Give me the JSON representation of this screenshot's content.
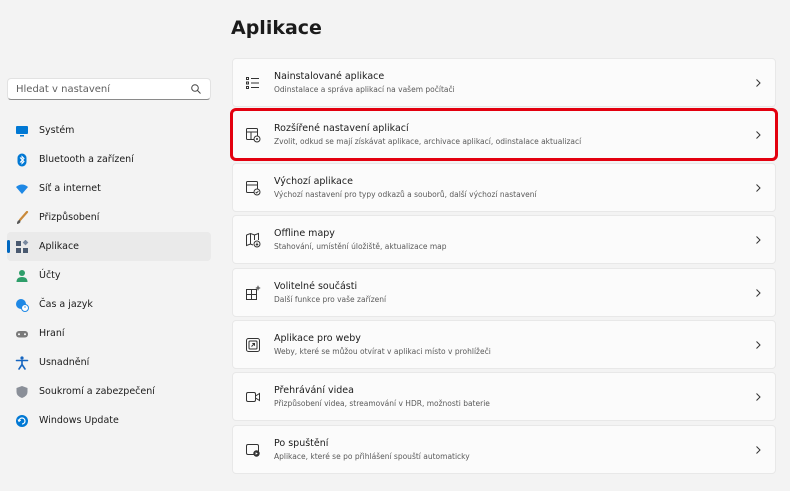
{
  "page": {
    "title": "Aplikace"
  },
  "search": {
    "placeholder": "Hledat v nastavení"
  },
  "sidebar": {
    "items": [
      {
        "label": "Systém",
        "icon": "monitor-icon",
        "color": "#0078d4"
      },
      {
        "label": "Bluetooth a zařízení",
        "icon": "bluetooth-icon",
        "color": "#0078d4"
      },
      {
        "label": "Síť a internet",
        "icon": "wifi-icon",
        "color": "#1e88e5"
      },
      {
        "label": "Přizpůsobení",
        "icon": "brush-icon",
        "color": "#c98a3a"
      },
      {
        "label": "Aplikace",
        "icon": "apps-icon",
        "color": "#4a5a70",
        "active": true
      },
      {
        "label": "Účty",
        "icon": "person-icon",
        "color": "#2e9e6a"
      },
      {
        "label": "Čas a jazyk",
        "icon": "globe-clock-icon",
        "color": "#1e88e5"
      },
      {
        "label": "Hraní",
        "icon": "gamepad-icon",
        "color": "#7a7a7a"
      },
      {
        "label": "Usnadnění",
        "icon": "accessibility-icon",
        "color": "#1565c0"
      },
      {
        "label": "Soukromí a zabezpečení",
        "icon": "shield-icon",
        "color": "#8a8f98"
      },
      {
        "label": "Windows Update",
        "icon": "update-icon",
        "color": "#0078d4"
      }
    ]
  },
  "cards": [
    {
      "title": "Nainstalované aplikace",
      "subtitle": "Odinstalace a správa aplikací na vašem počítači",
      "icon": "list-icon"
    },
    {
      "title": "Rozšířené nastavení aplikací",
      "subtitle": "Zvolit, odkud se mají získávat aplikace, archivace aplikací, odinstalace aktualizací",
      "icon": "app-settings-icon",
      "highlight": true
    },
    {
      "title": "Výchozí aplikace",
      "subtitle": "Výchozí nastavení pro typy odkazů a souborů, další výchozí nastavení",
      "icon": "default-apps-icon"
    },
    {
      "title": "Offline mapy",
      "subtitle": "Stahování, umístění úložiště, aktualizace map",
      "icon": "map-icon"
    },
    {
      "title": "Volitelné součásti",
      "subtitle": "Další funkce pro vaše zařízení",
      "icon": "add-feature-icon"
    },
    {
      "title": "Aplikace pro weby",
      "subtitle": "Weby, které se můžou otvírat v aplikaci místo v prohlížeči",
      "icon": "open-in-app-icon"
    },
    {
      "title": "Přehrávání videa",
      "subtitle": "Přizpůsobení videa, streamování v HDR, možnosti baterie",
      "icon": "video-icon"
    },
    {
      "title": "Po spuštění",
      "subtitle": "Aplikace, které se po přihlášení spouští automaticky",
      "icon": "startup-icon"
    }
  ]
}
